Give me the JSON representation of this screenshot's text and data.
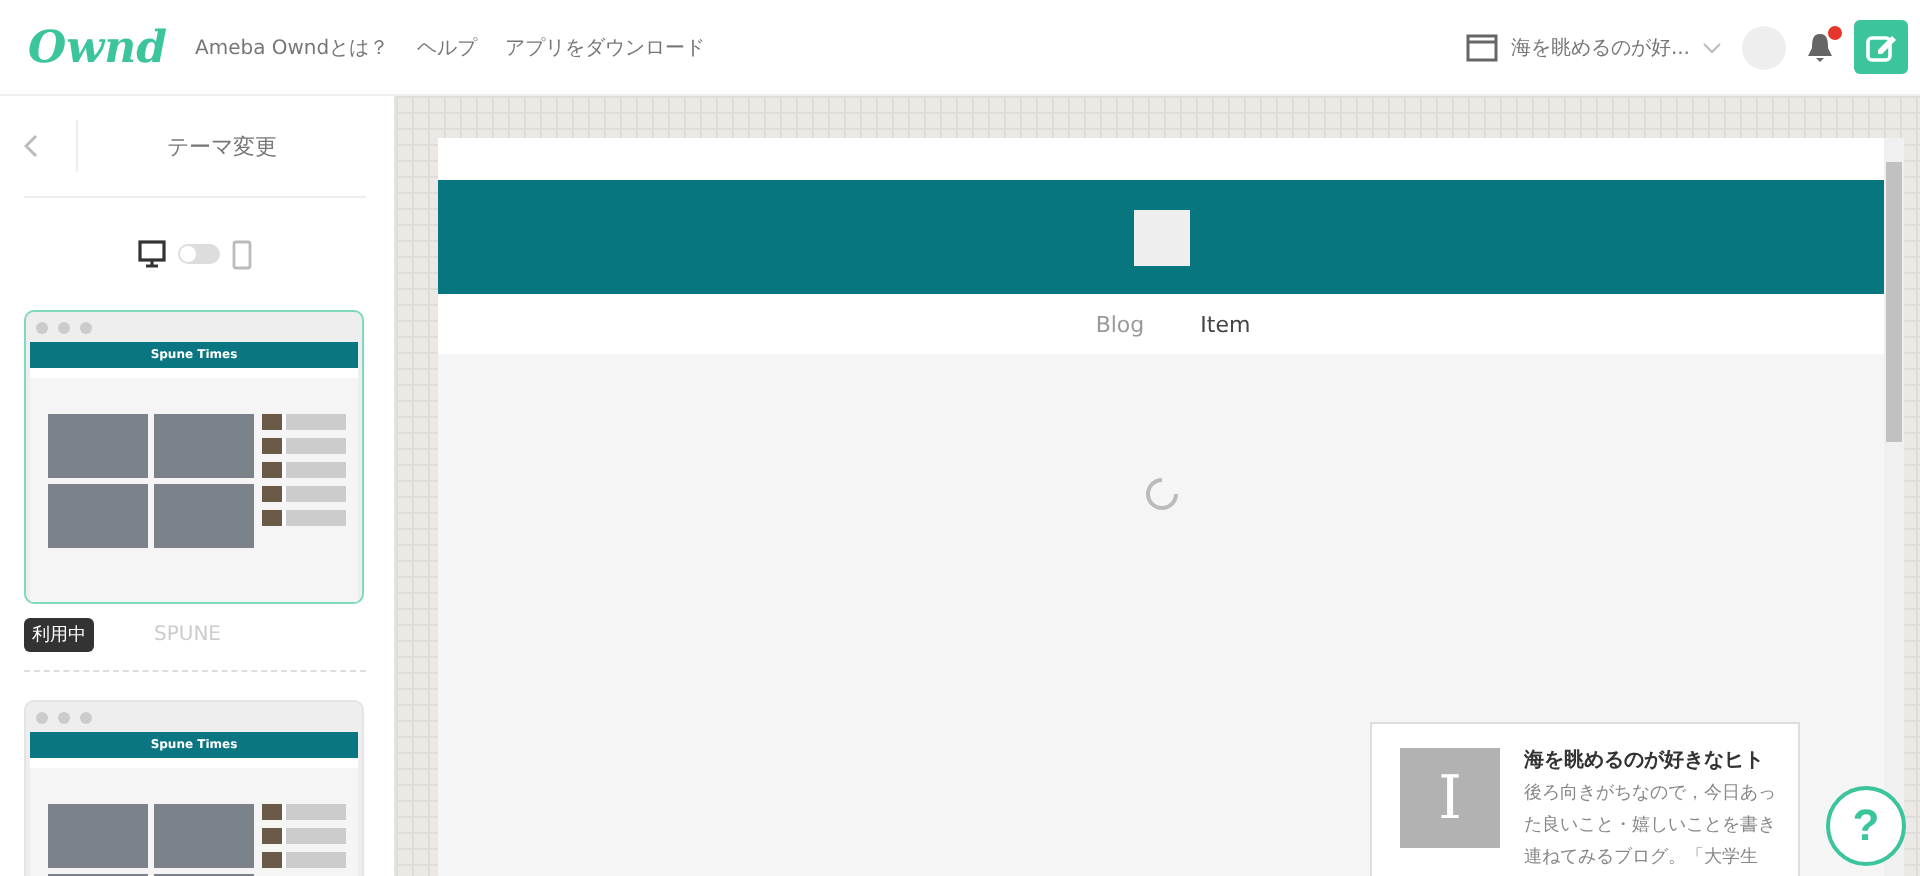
{
  "header": {
    "logo": "Ownd",
    "nav": [
      "Ameba Owndとは？",
      "ヘルプ",
      "アプリをダウンロード"
    ],
    "site_selector": "海を眺めるのが好...",
    "has_notification": true
  },
  "sidebar": {
    "title": "テーマ変更",
    "mobile_view": false,
    "themes": [
      {
        "preview_title": "Spune Times",
        "badge": "利用中",
        "name": "SPUNE",
        "selected": true
      },
      {
        "preview_title": "Spune Times",
        "selected": false
      }
    ]
  },
  "preview": {
    "nav": [
      {
        "label": "Blog",
        "selected": false
      },
      {
        "label": "Item",
        "selected": true
      }
    ],
    "loading": true,
    "profile": {
      "avatar_letter": "I",
      "name": "海を眺めるのが好きなヒト",
      "bio": "後ろ向きがちなので，今日あった良いこと・嬉しいことを書き連ねてみるブログ。「大学生"
    }
  },
  "help_button": "?"
}
